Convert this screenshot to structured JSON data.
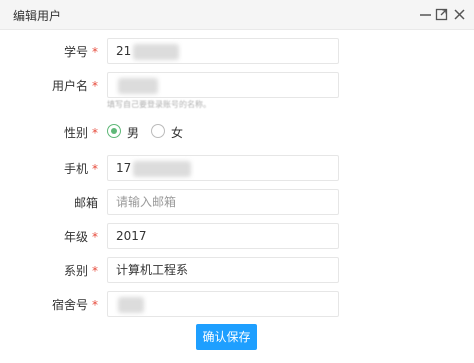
{
  "window": {
    "title": "编辑用户"
  },
  "form": {
    "student_id": {
      "label": "学号",
      "required": "*",
      "value": "21"
    },
    "username": {
      "label": "用户名",
      "required": "*",
      "value": "",
      "hint": "填写自己要登录账号的名称。"
    },
    "gender": {
      "label": "性别",
      "required": "*",
      "options": [
        "男",
        "女"
      ],
      "selected": "男"
    },
    "phone": {
      "label": "手机",
      "required": "*",
      "value": "17"
    },
    "email": {
      "label": "邮箱",
      "placeholder": "请输入邮箱"
    },
    "grade": {
      "label": "年级",
      "required": "*",
      "value": "2017"
    },
    "department": {
      "label": "系别",
      "required": "*",
      "value": "计算机工程系"
    },
    "dorm": {
      "label": "宿舍号",
      "required": "*",
      "value": ""
    }
  },
  "actions": {
    "save_label": "确认保存"
  },
  "colors": {
    "accent": "#1e9fff",
    "radio_checked": "#5fb878",
    "required": "#e74c3c"
  }
}
